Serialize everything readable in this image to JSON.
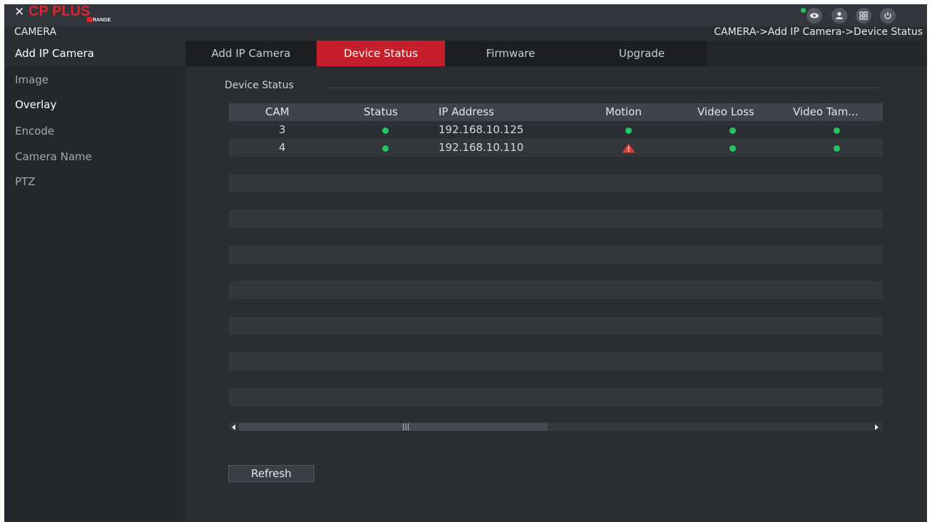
{
  "app": {
    "logo_text": "CP PLUS",
    "logo_sub": "RANGE",
    "logo_x": "✕"
  },
  "topbar": {
    "icons": [
      "eye-icon",
      "user-icon",
      "grid-icon",
      "power-icon"
    ]
  },
  "header": {
    "section_title": "CAMERA",
    "breadcrumb": "CAMERA->Add IP Camera->Device Status"
  },
  "sidebar": {
    "items": [
      {
        "label": "Add IP Camera"
      },
      {
        "label": "Image"
      },
      {
        "label": "Overlay"
      },
      {
        "label": "Encode"
      },
      {
        "label": "Camera Name"
      },
      {
        "label": "PTZ"
      }
    ]
  },
  "tabs": [
    {
      "label": "Add IP Camera",
      "active": false
    },
    {
      "label": "Device Status",
      "active": true
    },
    {
      "label": "Firmware",
      "active": false
    },
    {
      "label": "Upgrade",
      "active": false
    }
  ],
  "device_status": {
    "group_label": "Device Status",
    "columns": [
      "CAM",
      "Status",
      "IP Address",
      "Motion",
      "Video Loss",
      "Video Tam..."
    ],
    "rows": [
      {
        "cam": "3",
        "status": "ok",
        "ip": "192.168.10.125",
        "motion": "ok",
        "video_loss": "ok",
        "video_tamper": "ok"
      },
      {
        "cam": "4",
        "status": "ok",
        "ip": "192.168.10.110",
        "motion": "warning",
        "video_loss": "ok",
        "video_tamper": "ok"
      }
    ],
    "scroll_grip": "|||"
  },
  "actions": {
    "refresh_label": "Refresh"
  },
  "colors": {
    "accent": "#c41f2b",
    "ok": "#22c55e",
    "warning": "#e53935",
    "background": "#2a2d32"
  }
}
